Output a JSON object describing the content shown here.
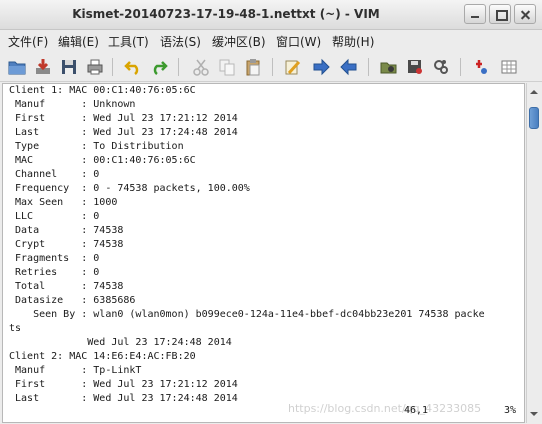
{
  "window": {
    "title": "Kismet-20140723-17-19-48-1.nettxt (~) - VIM"
  },
  "menus": [
    "文件(F)",
    "编辑(E)",
    "工具(T)",
    "语法(S)",
    "缓冲区(B)",
    "窗口(W)",
    "帮助(H)"
  ],
  "toolbar_icons": [
    "open-icon",
    "save-down-icon",
    "floppy-icon",
    "print-icon",
    "undo-icon",
    "redo-icon",
    "cut-icon",
    "copy-icon",
    "paste-icon",
    "find-replace-icon",
    "find-next-icon",
    "find-prev-icon",
    "load-session-icon",
    "save-session-icon",
    "run-script-icon",
    "make-icon",
    "ctags-icon"
  ],
  "editor_lines": [
    "Client 1: MAC 00:C1:40:76:05:6C",
    " Manuf      : Unknown",
    " First      : Wed Jul 23 17:21:12 2014",
    " Last       : Wed Jul 23 17:24:48 2014",
    " Type       : To Distribution",
    " MAC        : 00:C1:40:76:05:6C",
    " Channel    : 0",
    " Frequency  : 0 - 74538 packets, 100.00%",
    " Max Seen   : 1000",
    " LLC        : 0",
    " Data       : 74538",
    " Crypt      : 74538",
    " Fragments  : 0",
    " Retries    : 0",
    " Total      : 74538",
    " Datasize   : 6385686",
    "    Seen By : wlan0 (wlan0mon) b099ece0-124a-11e4-bbef-dc04bb23e201 74538 packe",
    "ts",
    "             Wed Jul 23 17:24:48 2014",
    "Client 2: MAC 14:E6:E4:AC:FB:20",
    " Manuf      : Tp-LinkT",
    " First      : Wed Jul 23 17:21:12 2014",
    " Last       : Wed Jul 23 17:24:48 2014"
  ],
  "status": {
    "position": "46,1",
    "percent": "3%"
  },
  "watermark": "https://blog.csdn.net/qq_43233085"
}
